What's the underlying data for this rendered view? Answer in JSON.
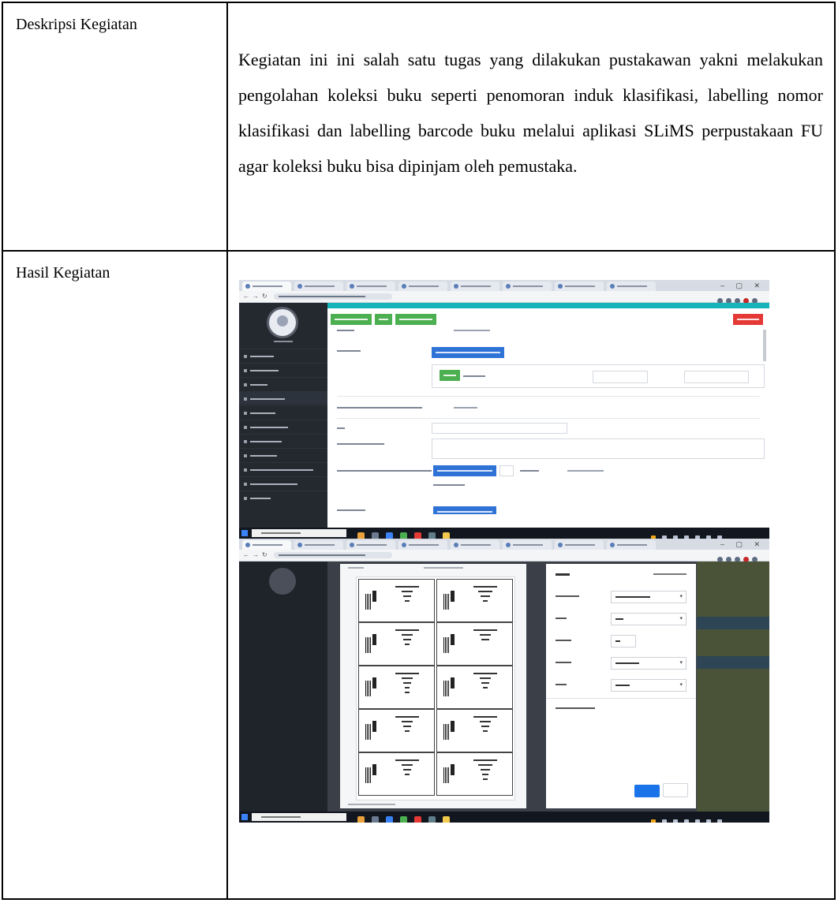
{
  "table": {
    "rows": [
      {
        "label": "Deskripsi Kegiatan",
        "text": "Kegiatan ini ini salah satu tugas yang dilakukan pustakawan yakni melakukan pengolahan koleksi buku seperti penomoran induk klasifikasi, labelling nomor klasifikasi dan labelling barcode buku melalui aplikasi SLiMS perpustakaan FU agar koleksi buku bisa dipinjam oleh pemustaka."
      },
      {
        "label": "Hasil Kegiatan"
      }
    ]
  },
  "screenshots": [
    {
      "description": "SLiMS admin bibliography form",
      "colors": {
        "sidebar": "#24282f",
        "accent": "#16b3bb",
        "green": "#4caf50",
        "red": "#e53935",
        "blue": "#2f73d6"
      },
      "icons": [
        "user-avatar-icon",
        "windows-start-icon",
        "search-icon",
        "chrome-icon"
      ]
    },
    {
      "description": "Browser print dialog with barcode label sheet",
      "colors": {
        "overlay": "#3a3f48",
        "print_button": "#1a73e8"
      },
      "icons": [
        "barcode-icon",
        "dropdown-chevron-icon"
      ]
    }
  ]
}
